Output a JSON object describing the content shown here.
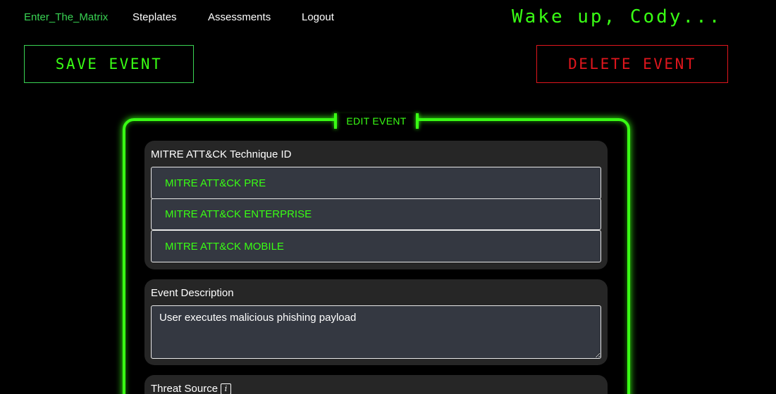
{
  "nav": {
    "brand": "Enter_The_Matrix",
    "links": [
      "Steplates",
      "Assessments",
      "Logout"
    ],
    "greeting": "Wake up, Cody..."
  },
  "actions": {
    "save_label": "SAVE EVENT",
    "delete_label": "DELETE EVENT"
  },
  "panel": {
    "legend": "EDIT EVENT"
  },
  "mitre": {
    "label": "MITRE ATT&CK Technique ID",
    "options": [
      "MITRE ATT&CK PRE",
      "MITRE ATT&CK ENTERPRISE",
      "MITRE ATT&CK MOBILE"
    ]
  },
  "description": {
    "label": "Event Description",
    "value": "User executes malicious phishing payload"
  },
  "threat_source": {
    "label": "Threat Source",
    "info_icon": "info-icon",
    "info_glyph": "i"
  },
  "colors": {
    "background": "#000000",
    "accent_green": "#39ff14",
    "danger_red": "#e0161d",
    "card_bg": "#262626",
    "input_bg": "#343841"
  }
}
